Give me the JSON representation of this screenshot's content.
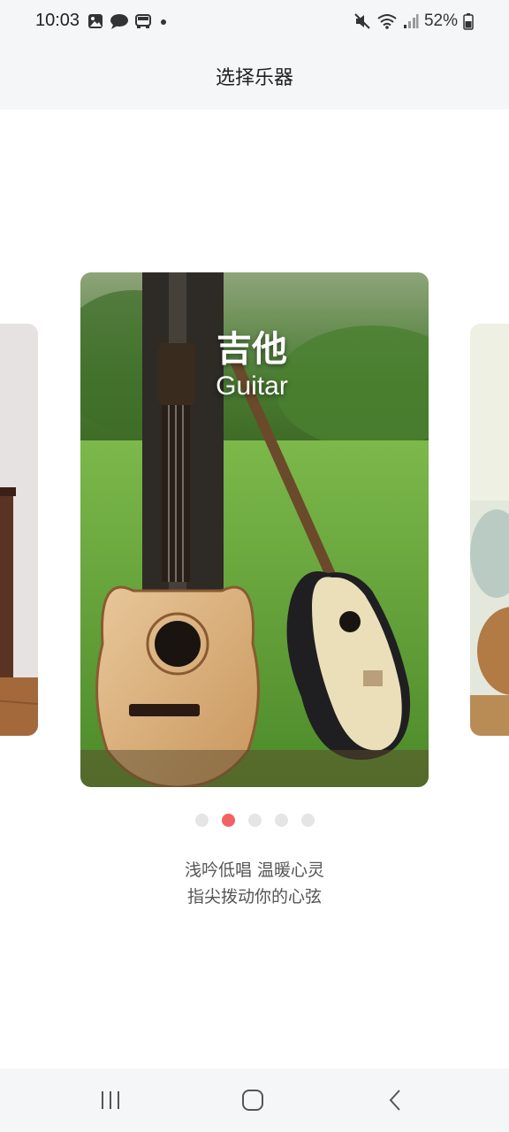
{
  "status_bar": {
    "time": "10:03",
    "battery": "52%",
    "left_icons": [
      "image-icon",
      "chat-bubble-icon",
      "car-icon",
      "dot-icon"
    ],
    "right_icons": [
      "mute-icon",
      "wifi-icon",
      "signal-icon",
      "battery-icon"
    ]
  },
  "header": {
    "title": "选择乐器"
  },
  "carousel": {
    "current": {
      "name_cn": "吉他",
      "name_en": "Guitar"
    },
    "page_count": 5,
    "active_index": 1
  },
  "description": {
    "line1": "浅吟低唱 温暖心灵",
    "line2": "指尖拨动你的心弦"
  },
  "nav_bar": {
    "buttons": [
      "recent-apps-icon",
      "home-icon",
      "back-icon"
    ]
  },
  "colors": {
    "accent_dot": "#f26262",
    "inactive_dot": "#e5e5e5",
    "bar_bg": "#f5f6f8"
  }
}
